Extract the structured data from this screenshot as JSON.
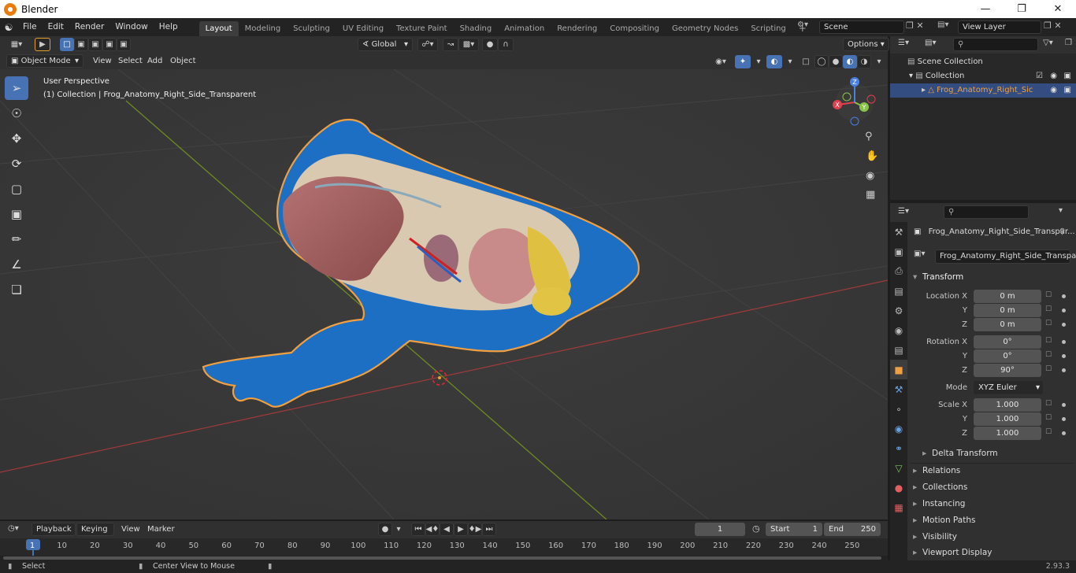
{
  "window": {
    "title": "Blender"
  },
  "menu": [
    "File",
    "Edit",
    "Render",
    "Window",
    "Help"
  ],
  "workspaces": [
    "Layout",
    "Modeling",
    "Sculpting",
    "UV Editing",
    "Texture Paint",
    "Shading",
    "Animation",
    "Rendering",
    "Compositing",
    "Geometry Nodes",
    "Scripting"
  ],
  "active_workspace": "Layout",
  "scene": {
    "name": "Scene",
    "view_layer": "View Layer"
  },
  "viewport_header": {
    "mode": "Object Mode",
    "menus": [
      "View",
      "Select",
      "Add",
      "Object"
    ],
    "orientation": "Global",
    "options_label": "Options"
  },
  "viewport": {
    "perspective_label": "User Perspective",
    "collection_label": "(1) Collection | Frog_Anatomy_Right_Side_Transparent",
    "gizmo": {
      "x": "X",
      "y": "Y",
      "z": "Z"
    }
  },
  "outliner": {
    "items": [
      {
        "label": "Scene Collection"
      },
      {
        "label": "Collection"
      },
      {
        "label": "Frog_Anatomy_Right_Sic"
      }
    ]
  },
  "properties": {
    "object_title": "Frog_Anatomy_Right_Side_Transpar...",
    "object_name": "Frog_Anatomy_Right_Side_Transparent",
    "transform_label": "Transform",
    "location": {
      "label_x": "Location X",
      "label_y": "Y",
      "label_z": "Z",
      "x": "0 m",
      "y": "0 m",
      "z": "0 m"
    },
    "rotation": {
      "label_x": "Rotation X",
      "label_y": "Y",
      "label_z": "Z",
      "x": "0°",
      "y": "0°",
      "z": "90°"
    },
    "mode": {
      "label": "Mode",
      "value": "XYZ Euler"
    },
    "scale": {
      "label_x": "Scale X",
      "label_y": "Y",
      "label_z": "Z",
      "x": "1.000",
      "y": "1.000",
      "z": "1.000"
    },
    "delta_transform": "Delta Transform",
    "panels": [
      "Relations",
      "Collections",
      "Instancing",
      "Motion Paths",
      "Visibility",
      "Viewport Display"
    ]
  },
  "timeline": {
    "menus": [
      "Playback",
      "Keying",
      "View",
      "Marker"
    ],
    "current_frame": "1",
    "start_label": "Start",
    "start": "1",
    "end_label": "End",
    "end": "250",
    "ticks": [
      "1",
      "10",
      "20",
      "30",
      "40",
      "50",
      "60",
      "70",
      "80",
      "90",
      "100",
      "110",
      "120",
      "130",
      "140",
      "150",
      "160",
      "170",
      "180",
      "190",
      "200",
      "210",
      "220",
      "230",
      "240",
      "250"
    ]
  },
  "status": {
    "left": "Select",
    "middle": "Center View to Mouse",
    "version": "2.93.3"
  },
  "colors": {
    "accent": "#4772b3",
    "selection_outline": "#f0a040",
    "frog_blue": "#1d6fc4",
    "grid_x": "#9c3a3a",
    "grid_y": "#6d8a22"
  }
}
